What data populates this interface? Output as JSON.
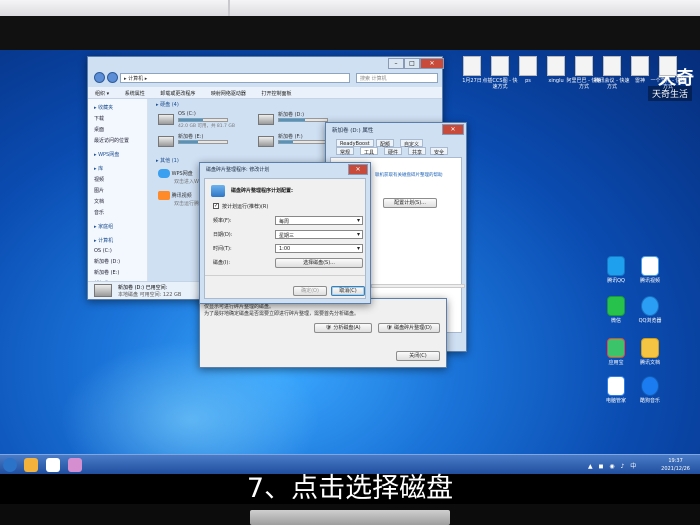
{
  "watermark": {
    "logo": "天奇",
    "subtitle": "天奇生活"
  },
  "desktop_icons_top": [
    {
      "label": "1月27日"
    },
    {
      "label": "点插CCS图 - 快速方式"
    },
    {
      "label": "ps"
    },
    {
      "label": "xinglu"
    },
    {
      "label": "阿里巴巴 - 快速方式"
    },
    {
      "label": "腾讯会议 - 快速方式"
    },
    {
      "label": "雷神"
    },
    {
      "label": "一个文件 - 快捷方式"
    }
  ],
  "desktop_icons_right": [
    {
      "label": "腾讯QQ"
    },
    {
      "label": "腾讯视频"
    },
    {
      "label": "微信"
    },
    {
      "label": "QQ浏览器"
    },
    {
      "label": "应用宝"
    },
    {
      "label": "腾讯文档"
    },
    {
      "label": "电脑管家"
    },
    {
      "label": "酷狗音乐"
    }
  ],
  "explorer": {
    "address": "▸ 计算机 ▸",
    "search_placeholder": "搜索 计算机",
    "menu": [
      "组织 ▾",
      "系统属性",
      "卸载或更改程序",
      "映射网络驱动器",
      "打开控制面板"
    ],
    "nav": [
      {
        "label": "收藏夹",
        "group": true
      },
      {
        "label": "下载",
        "group": false
      },
      {
        "label": "桌面",
        "group": false
      },
      {
        "label": "最近访问的位置",
        "group": false
      },
      {
        "label": "WPS网盘",
        "group": true
      },
      {
        "label": "库",
        "group": true
      },
      {
        "label": "视频",
        "group": false
      },
      {
        "label": "图片",
        "group": false
      },
      {
        "label": "文档",
        "group": false
      },
      {
        "label": "音乐",
        "group": false
      },
      {
        "label": "家庭组",
        "group": true
      },
      {
        "label": "计算机",
        "group": true
      },
      {
        "label": "OS (C:)",
        "group": false
      },
      {
        "label": "新加卷 (D:)",
        "group": false
      },
      {
        "label": "新加卷 (E:)",
        "group": false
      },
      {
        "label": "新加卷 (F:)",
        "group": false
      }
    ],
    "section_hdd": "▸ 硬盘 (4)",
    "section_other": "▸ 其他 (1)",
    "drives": [
      {
        "name": "OS (C:)",
        "free": "42.0 GB 可用，共 81.7 GB",
        "fill_percent": 49
      },
      {
        "name": "新加卷 (E:)",
        "free": "",
        "fill_percent": 40
      },
      {
        "name": "新加卷 (D:)",
        "free": "",
        "fill_percent": 55
      },
      {
        "name": "新加卷 (F:)",
        "free": "",
        "fill_percent": 30
      }
    ],
    "other": [
      {
        "name": "WPS网盘",
        "desc": "双击进入WPS网盘"
      },
      {
        "name": "腾讯视频",
        "desc": "双击运行腾讯视频"
      }
    ],
    "details_name": "新加卷 (D:)  已用空间:",
    "details_type": "本地磁盘  可用空间: 122 GB"
  },
  "properties": {
    "title": "新加卷 (D:) 属性",
    "tabs": [
      "ReadyBoost",
      "配额",
      "自定义",
      "常规",
      "工具",
      "硬件",
      "共享",
      "以前的版本",
      "安全"
    ],
    "schedule_button": "配置计划(S)...",
    "analyze_button": "分析磁盘(A)",
    "defrag_button": "磁盘碎片整理(D)",
    "info_text_1": "仅显示可进行碎片整理的磁盘。",
    "info_text_2": "为了最好地确定磁盘是否需要立即进行碎片整理，需要首先分析磁盘。",
    "close_button": "关闭(C)",
    "link_text": "联机获取有关磁盘碎片整理的帮助"
  },
  "schedule": {
    "title": "磁盘碎片整理程序",
    "subtitle": "磁盘碎片整理程序: 修改计划",
    "heading": "磁盘碎片整理程序计划配置:",
    "checkbox_label": "按计划运行(推荐)(R)",
    "checkbox_checked": true,
    "fields": [
      {
        "label": "频率(F):",
        "value": "每周"
      },
      {
        "label": "日期(D):",
        "value": "星期三"
      },
      {
        "label": "时间(T):",
        "value": "1:00"
      },
      {
        "label": "磁盘(I):",
        "value": "选择磁盘(S)..."
      }
    ],
    "ok_button": "确定(O)",
    "cancel_button": "取消(C)"
  },
  "taskbar": {
    "time": "19:37",
    "date": "2021/12/26",
    "tray": "▲ ◼ ◉ ♪ 中"
  },
  "caption": "7、点击选择磁盘"
}
